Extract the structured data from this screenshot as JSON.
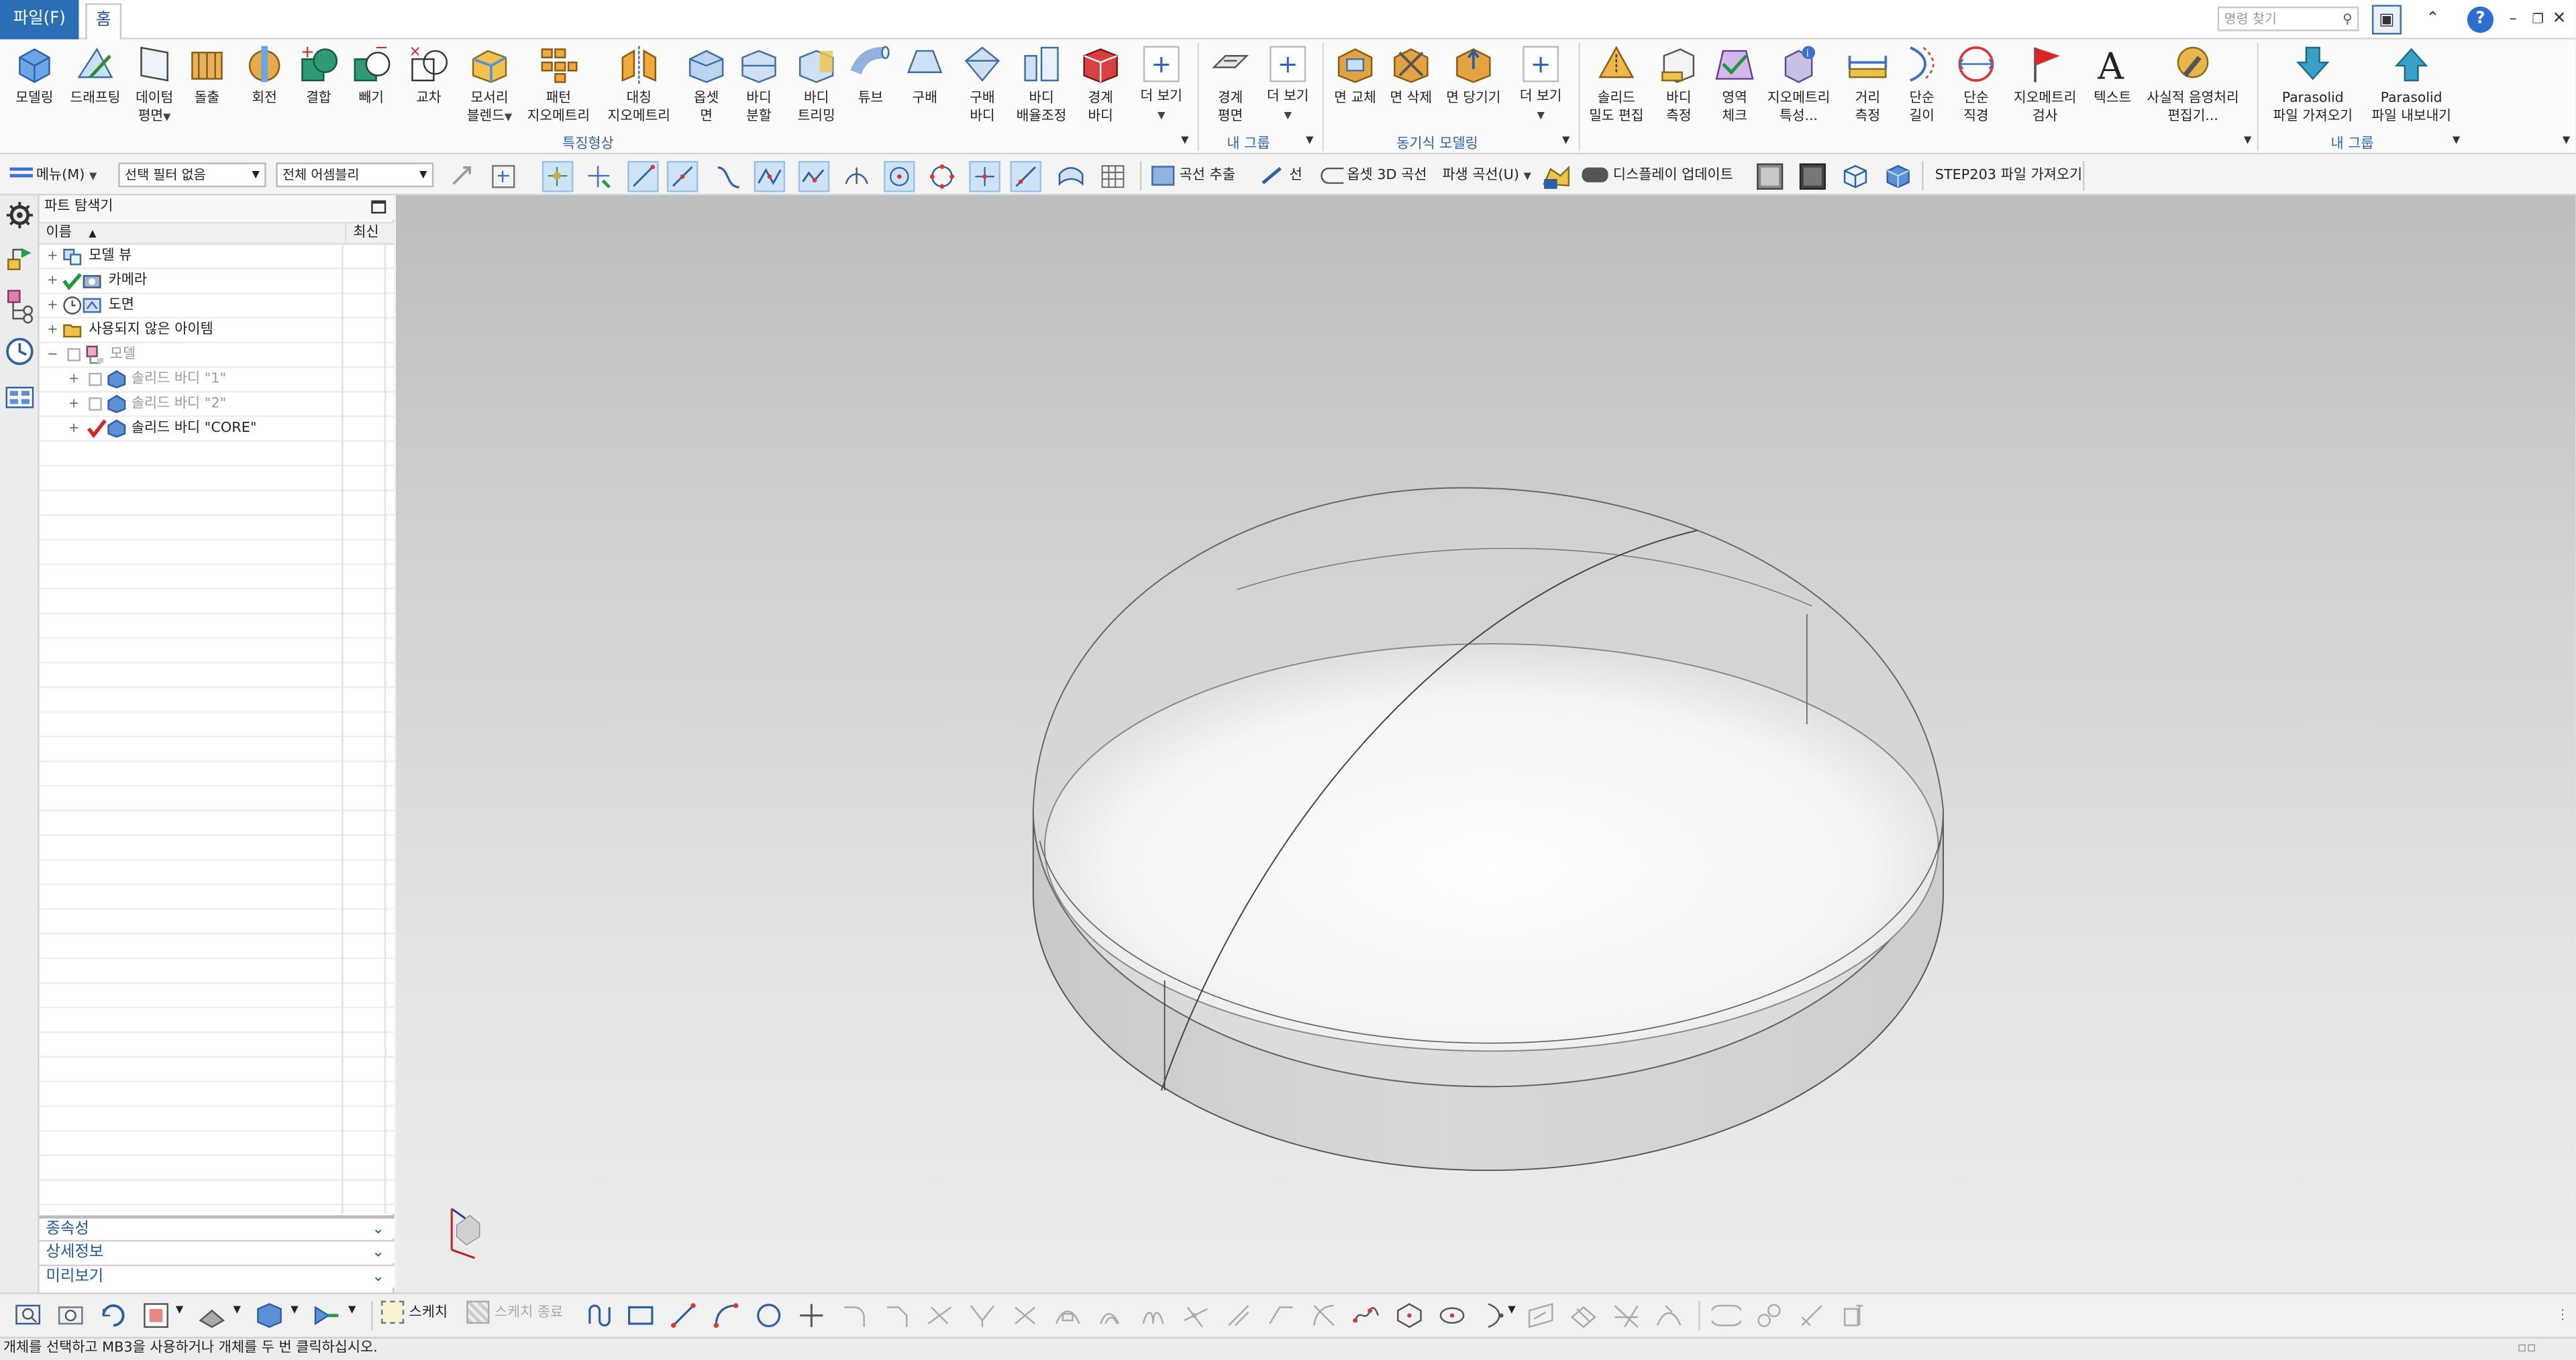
{
  "tabs": {
    "file": "파일(F)",
    "home": "홈"
  },
  "search": {
    "placeholder": "명령 찾기"
  },
  "ribbon": {
    "buttons": [
      {
        "l1": "모델링",
        "l2": ""
      },
      {
        "l1": "드래프팅",
        "l2": ""
      },
      {
        "l1": "데이텀",
        "l2": "평면"
      },
      {
        "l1": "돌출",
        "l2": ""
      },
      {
        "l1": "회전",
        "l2": ""
      },
      {
        "l1": "결합",
        "l2": ""
      },
      {
        "l1": "빼기",
        "l2": ""
      },
      {
        "l1": "교차",
        "l2": ""
      },
      {
        "l1": "모서리",
        "l2": "블렌드"
      },
      {
        "l1": "패턴",
        "l2": "지오메트리"
      },
      {
        "l1": "대칭",
        "l2": "지오메트리"
      },
      {
        "l1": "옵셋",
        "l2": "면"
      },
      {
        "l1": "바디",
        "l2": "분할"
      },
      {
        "l1": "바디",
        "l2": "트리밍"
      },
      {
        "l1": "튜브",
        "l2": ""
      },
      {
        "l1": "구배",
        "l2": ""
      },
      {
        "l1": "구배",
        "l2": "바디"
      },
      {
        "l1": "바디",
        "l2": "배율조정"
      },
      {
        "l1": "경계",
        "l2": "바디"
      },
      {
        "l1": "더 보기",
        "l2": ""
      },
      {
        "l1": "경계",
        "l2": "평면"
      },
      {
        "l1": "더 보기",
        "l2": ""
      },
      {
        "l1": "면 교체",
        "l2": ""
      },
      {
        "l1": "면 삭제",
        "l2": ""
      },
      {
        "l1": "면 당기기",
        "l2": ""
      },
      {
        "l1": "더 보기",
        "l2": ""
      },
      {
        "l1": "솔리드",
        "l2": "밀도 편집"
      },
      {
        "l1": "바디",
        "l2": "측정"
      },
      {
        "l1": "영역",
        "l2": "체크"
      },
      {
        "l1": "지오메트리",
        "l2": "특성..."
      },
      {
        "l1": "거리",
        "l2": "측정"
      },
      {
        "l1": "단순",
        "l2": "길이"
      },
      {
        "l1": "단순",
        "l2": "직경"
      },
      {
        "l1": "지오메트리",
        "l2": "검사"
      },
      {
        "l1": "텍스트",
        "l2": ""
      },
      {
        "l1": "사실적 음영처리",
        "l2": "편집기..."
      },
      {
        "l1": "Parasolid",
        "l2": "파일 가져오기"
      },
      {
        "l1": "Parasolid",
        "l2": "파일 내보내기"
      }
    ],
    "groups": {
      "feature": "특징형상",
      "mygroup1": "내 그룹",
      "sync": "동기식 모델링",
      "mygroup2": "내 그룹"
    }
  },
  "selection_bar": {
    "menu": "메뉴(M)",
    "filter": "선택 필터 없음",
    "assembly": "전체 어셈블리",
    "curve_extract": "곡선 추출",
    "line": "선",
    "offset_3d": "옵셋 3D 곡선",
    "derived_curve": "파생 곡선(U)",
    "display_update": "디스플레이 업데이트",
    "step_import": "STEP203 파일 가져오기"
  },
  "navigator": {
    "title": "파트 탐색기",
    "col_name": "이름",
    "col_latest": "최신",
    "nodes": {
      "model_views": "모델 뷰",
      "cameras": "카메라",
      "drawings": "도면",
      "unused": "사용되지 않은 아이템",
      "model": "모델",
      "body1": "솔리드 바디 \"1\"",
      "body2": "솔리드 바디 \"2\"",
      "core": "솔리드 바디 \"CORE\""
    },
    "panels": {
      "dependencies": "종속성",
      "details": "상세정보",
      "preview": "미리보기"
    }
  },
  "bottom_toolbar": {
    "sketch": "스케치",
    "finish_sketch": "스케치 종료"
  },
  "status": {
    "message": "개체를 선택하고 MB3을 사용하거나 개체를 두 번 클릭하십시오."
  },
  "colors": {
    "accent": "#2a6fb5",
    "ribbon_group_text": "#2a62b8",
    "panel_text": "#1f5aa8",
    "viewport_top": "#bdbdbd",
    "viewport_bottom": "#ececec"
  }
}
